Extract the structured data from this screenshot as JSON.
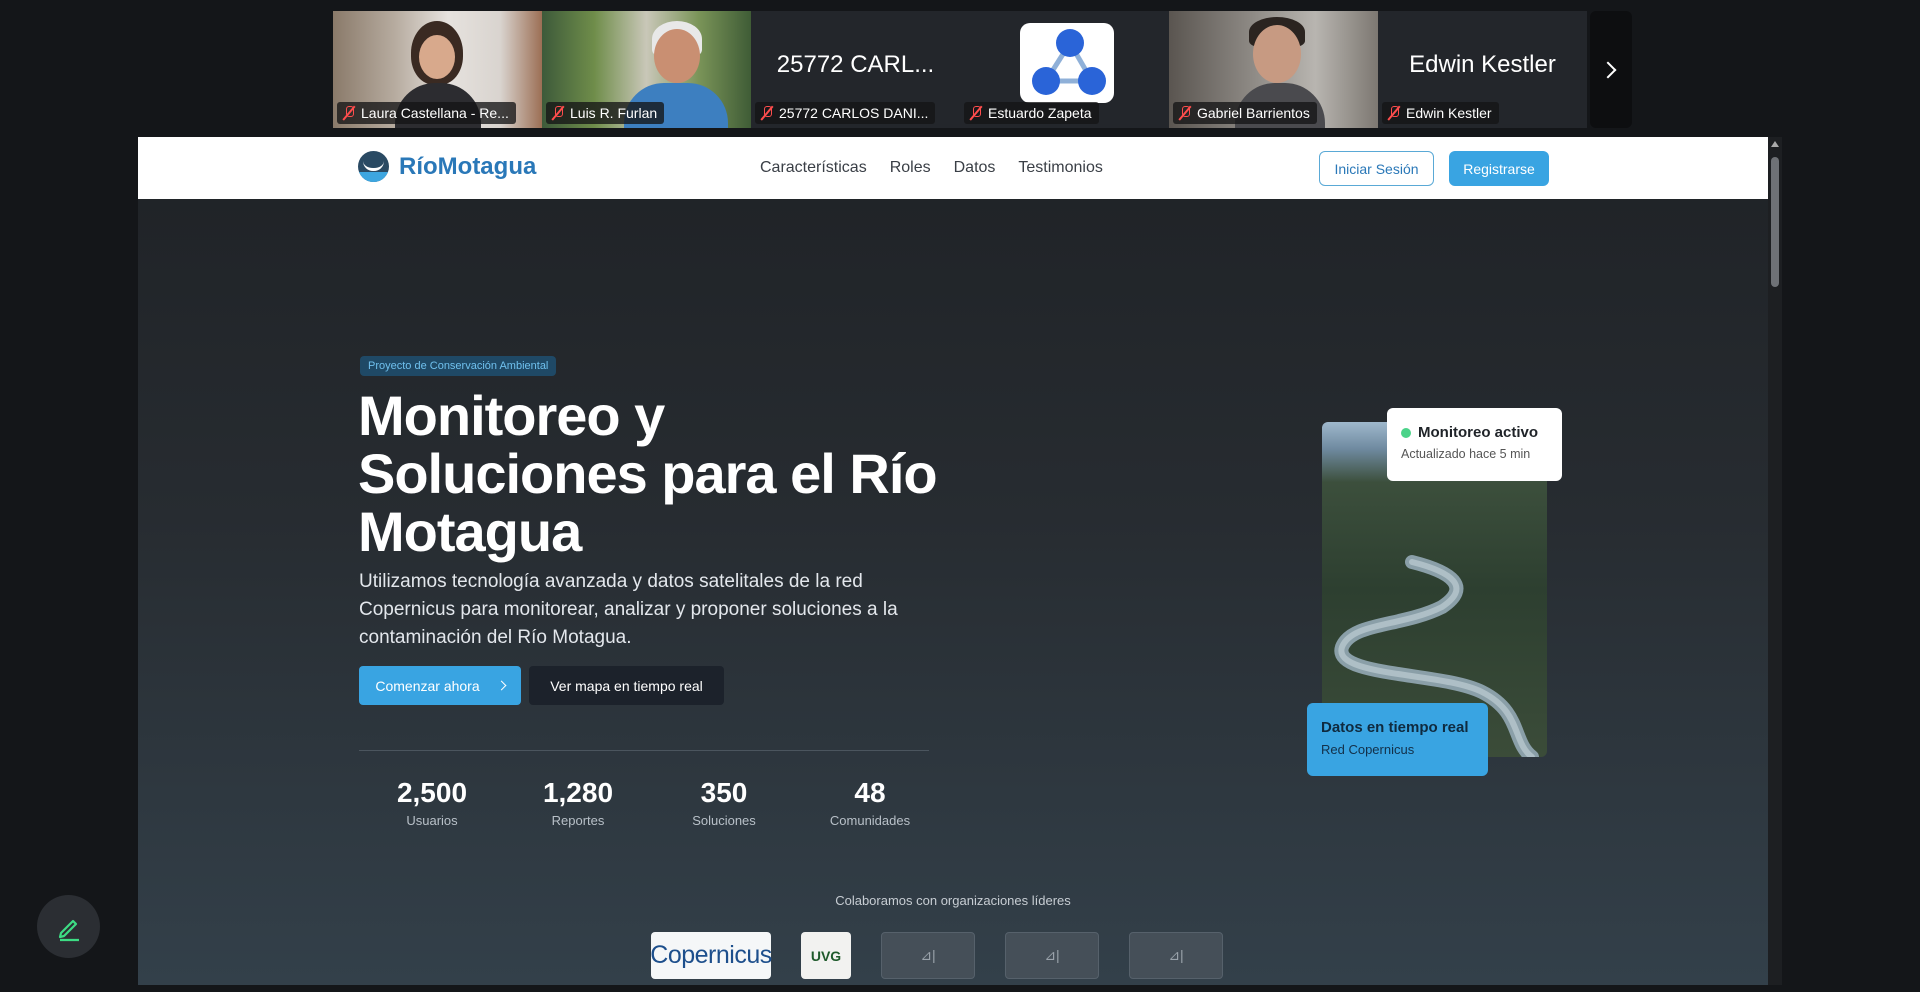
{
  "participants": [
    {
      "name": "Laura Castellana - Re...",
      "muted": true,
      "type": "video"
    },
    {
      "name": "Luis R. Furlan",
      "muted": true,
      "type": "video"
    },
    {
      "name": "25772 CARLOS DANI...",
      "display": "25772 CARL...",
      "muted": true,
      "type": "text"
    },
    {
      "name": "Estuardo Zapeta",
      "muted": true,
      "type": "avatar",
      "avatar_icon": "molecule-icon"
    },
    {
      "name": "Gabriel Barrientos",
      "muted": true,
      "type": "video"
    },
    {
      "name": "Edwin Kestler",
      "display": "Edwin Kestler",
      "muted": true,
      "type": "text"
    }
  ],
  "site": {
    "logo_text": "RíoMotagua",
    "nav": [
      "Características",
      "Roles",
      "Datos",
      "Testimonios"
    ],
    "login_label": "Iniciar Sesión",
    "register_label": "Registrarse"
  },
  "hero": {
    "badge": "Proyecto de Conservación Ambiental",
    "title": "Monitoreo y Soluciones para el Río Motagua",
    "subtitle": "Utilizamos tecnología avanzada y datos satelitales de la red Copernicus para monitorear, analizar y proponer soluciones a la contaminación del Río Motagua.",
    "cta_primary": "Comenzar ahora",
    "cta_secondary": "Ver mapa en tiempo real"
  },
  "stats": [
    {
      "value": "2,500",
      "label": "Usuarios"
    },
    {
      "value": "1,280",
      "label": "Reportes"
    },
    {
      "value": "350",
      "label": "Soluciones"
    },
    {
      "value": "48",
      "label": "Comunidades"
    }
  ],
  "cards": {
    "live_title": "Monitoreo activo",
    "live_sub": "Actualizado hace 5 min",
    "rt_title": "Datos en tiempo real",
    "rt_sub": "Red Copernicus"
  },
  "partners": {
    "heading": "Colaboramos con organizaciones líderes",
    "copernicus": "Copernicus",
    "uvg": "UVG"
  },
  "colors": {
    "accent": "#39a4e2",
    "brand": "#2a78b8",
    "live_dot": "#4bd389",
    "muted_icon": "#ff4d4d"
  }
}
